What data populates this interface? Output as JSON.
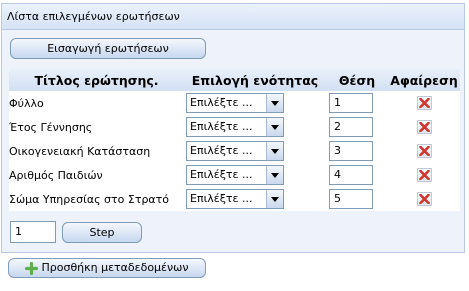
{
  "panel": {
    "title": "Λίστα επιλεγμένων ερωτήσεων",
    "insert_button": "Εισαγωγή ερωτήσεων"
  },
  "table": {
    "headers": [
      "Τίτλος ερώτησης.",
      "Επιλογή ενότητας",
      "Θέση",
      "Αφαίρεση"
    ],
    "rows": [
      {
        "title": "Φύλλο",
        "section": "Επιλέξτε ...",
        "position": "1",
        "remove_icon": "red-x-icon"
      },
      {
        "title": "Έτος Γέννησης",
        "section": "Επιλέξτε ...",
        "position": "2",
        "remove_icon": "red-x-icon"
      },
      {
        "title": "Οικογενειακή Κατάσταση",
        "section": "Επιλέξτε ...",
        "position": "3",
        "remove_icon": "red-x-icon"
      },
      {
        "title": "Αριθμός Παιδιών",
        "section": "Επιλέξτε ...",
        "position": "4",
        "remove_icon": "red-x-icon"
      },
      {
        "title": "Σώμα Υπηρεσίας στο Στρατό",
        "section": "Επιλέξτε ...",
        "position": "5",
        "remove_icon": "red-x-icon"
      }
    ]
  },
  "step": {
    "value": "1",
    "button_label": "Step"
  },
  "add_metadata": {
    "label": "Προσθήκη μεταδεδομένων",
    "icon": "green-plus-icon"
  },
  "colors": {
    "panel_bg": "#eef3fb",
    "border": "#b8c8e0",
    "delete_red": "#d0342c",
    "plus_green": "#5fb04a"
  }
}
